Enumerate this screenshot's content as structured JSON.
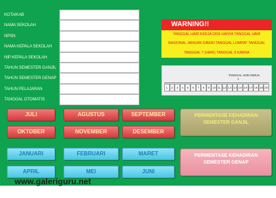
{
  "form": {
    "fields": [
      {
        "label": "KOTA/KAB",
        "value": ""
      },
      {
        "label": "NAMA SEKOLAH",
        "value": ""
      },
      {
        "label": "NPSN",
        "value": ""
      },
      {
        "label": "NAMA KEPALA SEKOLAH",
        "value": ""
      },
      {
        "label": "NIP KEPALA SEKOLAH",
        "value": ""
      },
      {
        "label": "TAHUN SEMESTER GANJIL",
        "value": ""
      },
      {
        "label": "TAHUN SEMESTER GENAP",
        "value": ""
      },
      {
        "label": "TAHUN PELAJARAN",
        "value": ""
      },
      {
        "label": "TANGGAL OTOMATIS",
        "value": ""
      }
    ]
  },
  "warning": {
    "title": "WARNING!!",
    "lines": [
      "TANGGAL HARI KERJA DIISI HANYA TANGGAL HARI",
      "NASIONAL JANGAN DIBERI TANGGAL LOMPAT TANGGAL",
      "TANGGAL 7 (HARI) TANGGAL 8 KARNA"
    ]
  },
  "date_scale": {
    "caption": "TANGGAL HARI KERJA",
    "pointer": "♀",
    "days": [
      "1",
      "2",
      "3",
      "4",
      "5",
      "6",
      "7",
      "8",
      "9",
      "10",
      "11",
      "12",
      "13",
      "14",
      "15",
      "16",
      "17",
      "18",
      "19",
      "20"
    ]
  },
  "months": {
    "row1": [
      "JULI",
      "AGUSTUS",
      "SEPTEMBER"
    ],
    "row2": [
      "OKTOBER",
      "NOVEMBER",
      "DESEMBER"
    ],
    "row3": [
      "JANUARI",
      "FEBRUARI",
      "MARET"
    ],
    "row4": [
      "APRIL",
      "MEI",
      "JUNI"
    ]
  },
  "actions": {
    "ganjil": "PERMENTASE KEHADIRAN SEMESTER GANJIL",
    "genap": "PERMENTASE KEHADIRAN SEMESTER GENAP"
  },
  "watermark": "www.galeriguru.net",
  "colors": {
    "background": "#0fa24f",
    "warning_red": "#ea2626",
    "warning_yellow": "#f8ef1e",
    "button_red": "#d83a3a",
    "button_blue": "#4cc6e6",
    "button_olive": "#a9a26a",
    "button_pink": "#e991a0"
  }
}
